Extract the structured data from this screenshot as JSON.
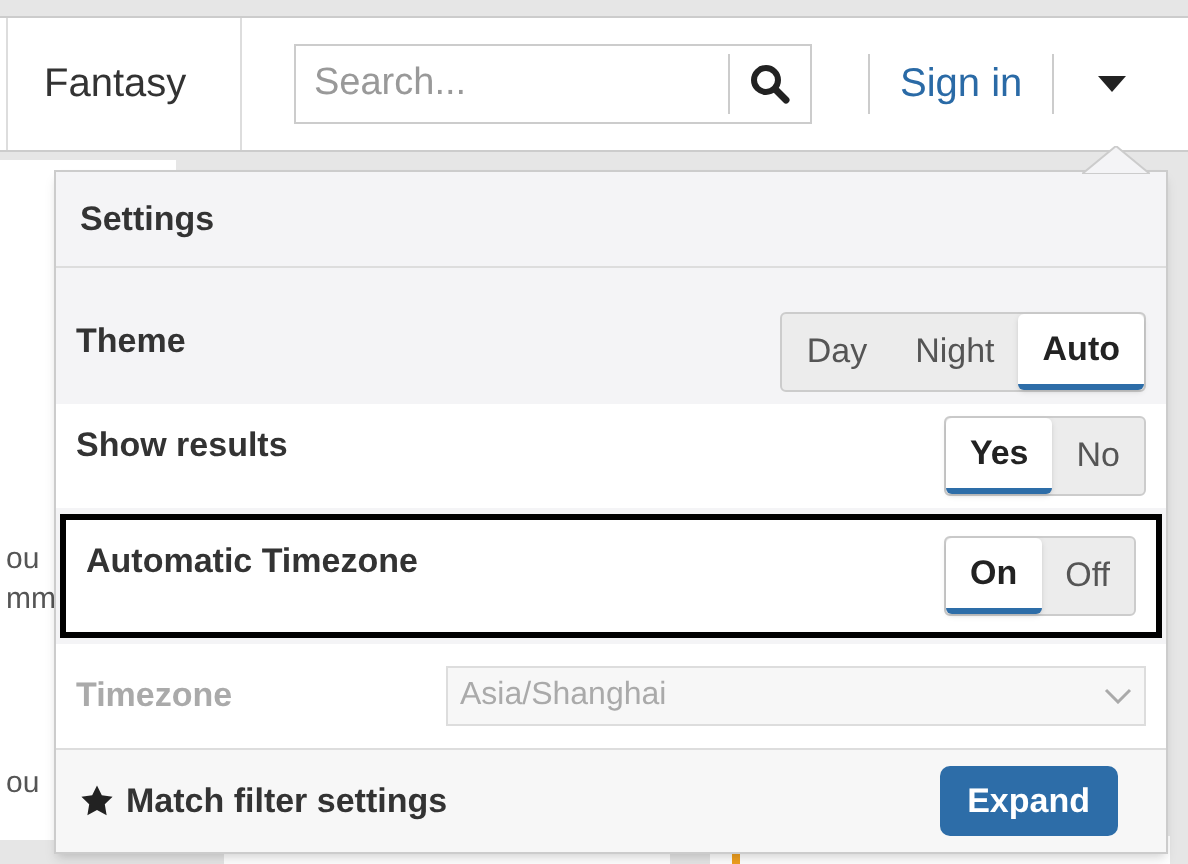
{
  "navbar": {
    "brand": "Fantasy",
    "search": {
      "placeholder": "Search..."
    },
    "sign_in": "Sign in"
  },
  "background": {
    "left_fragments": [
      "ou",
      "mm",
      "ou"
    ]
  },
  "settings": {
    "title": "Settings",
    "rows": [
      {
        "label": "Theme",
        "kind": "segmented",
        "highlighted": false,
        "disabled": false,
        "options": [
          {
            "label": "Day",
            "selected": false
          },
          {
            "label": "Night",
            "selected": false
          },
          {
            "label": "Auto",
            "selected": true
          }
        ]
      },
      {
        "label": "Show results",
        "kind": "segmented",
        "highlighted": false,
        "disabled": false,
        "options": [
          {
            "label": "Yes",
            "selected": true
          },
          {
            "label": "No",
            "selected": false
          }
        ]
      },
      {
        "label": "Automatic Timezone",
        "kind": "segmented",
        "highlighted": true,
        "disabled": false,
        "options": [
          {
            "label": "On",
            "selected": true
          },
          {
            "label": "Off",
            "selected": false
          }
        ]
      },
      {
        "label": "Timezone",
        "kind": "select",
        "highlighted": false,
        "disabled": true,
        "value": "Asia/Shanghai"
      }
    ],
    "footer": {
      "label": "Match filter settings",
      "button": "Expand"
    }
  }
}
